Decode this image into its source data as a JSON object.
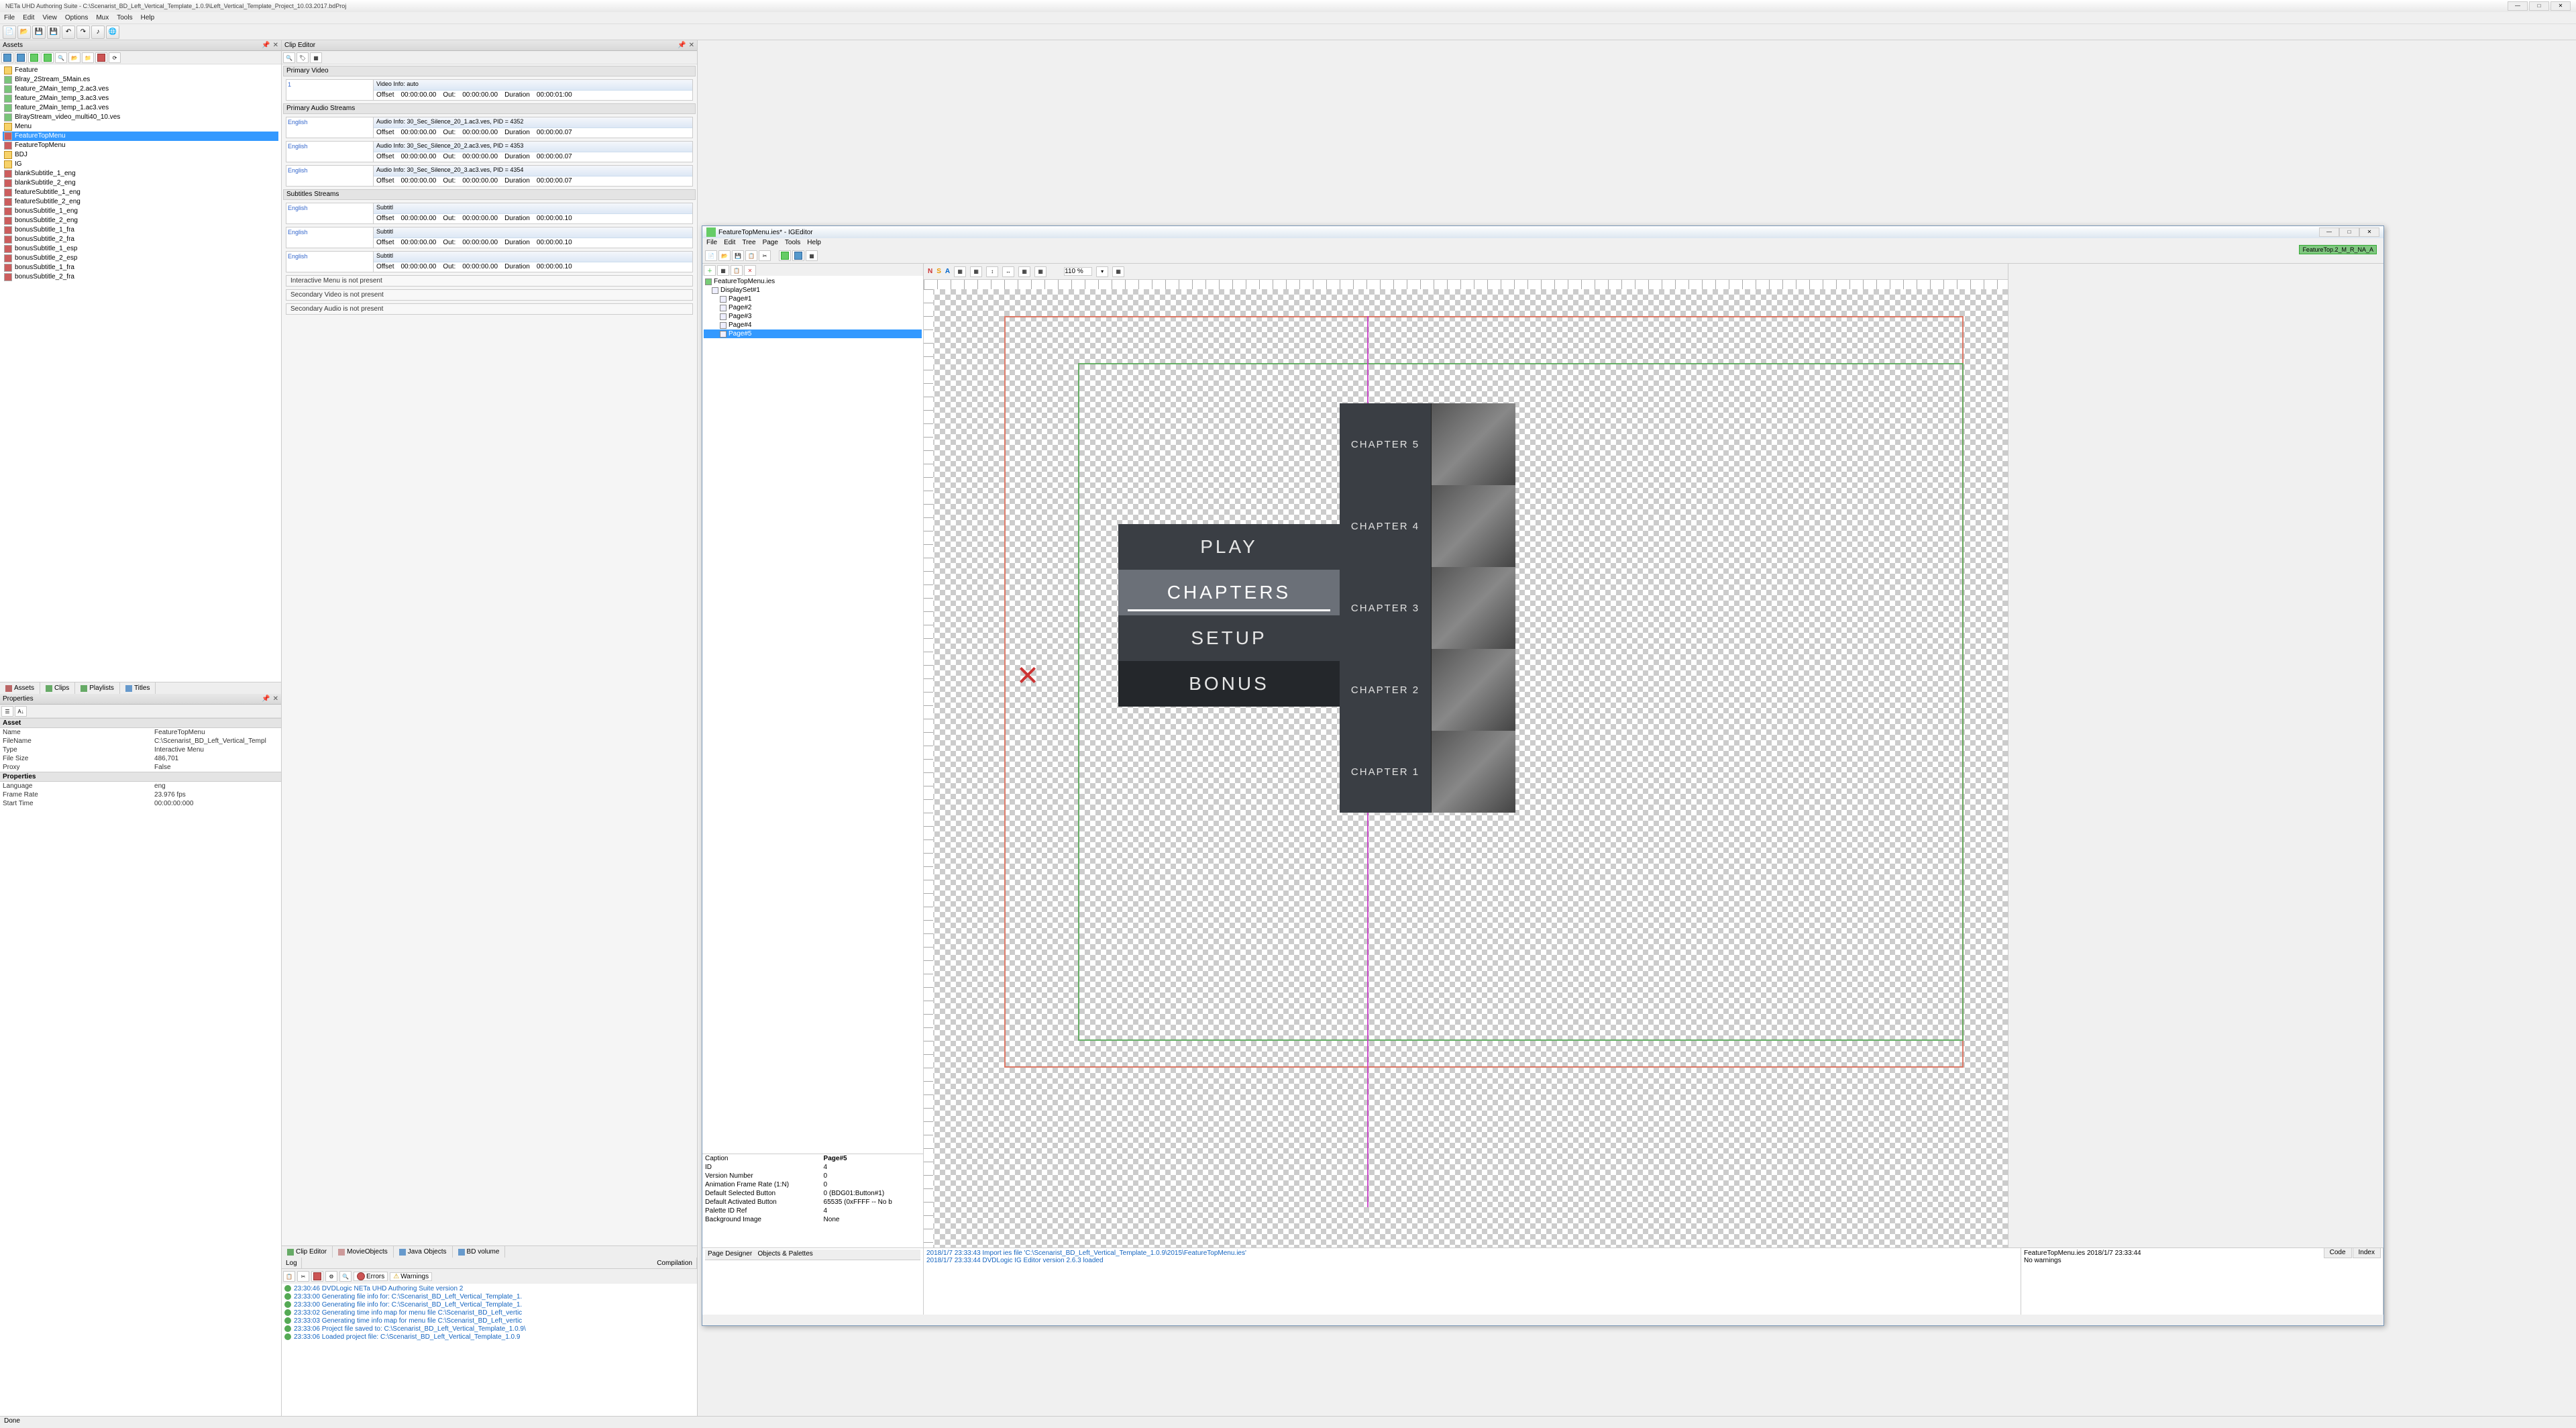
{
  "app": {
    "title": "NETa UHD Authoring Suite - C:\\Scenarist_BD_Left_Vertical_Template_1.0.9\\Left_Vertical_Template_Project_10.03.2017.bdProj",
    "status": "Done"
  },
  "main_menu": [
    "File",
    "Edit",
    "View",
    "Options",
    "Mux",
    "Tools",
    "Help"
  ],
  "assets_panel": {
    "title": "Assets",
    "folders": {
      "feature": "Feature",
      "feature_items": [
        "Blray_2Stream_5Main.es",
        "feature_2Main_temp_2.ac3.ves",
        "feature_2Main_temp_3.ac3.ves",
        "feature_2Main_temp_1.ac3.ves",
        "BlrayStream_video_multi40_10.ves"
      ],
      "menu": "Menu",
      "menu_items": [
        "FeatureTopMenu",
        "FeatureTopMenu"
      ],
      "bdj": "BDJ",
      "ig": "IG",
      "ig_items": [
        "blankSubtitle_1_eng",
        "blankSubtitle_2_eng",
        "featureSubtitle_1_eng",
        "featureSubtitle_2_eng",
        "bonusSubtitle_1_eng",
        "bonusSubtitle_2_eng",
        "bonusSubtitle_1_fra",
        "bonusSubtitle_2_fra",
        "bonusSubtitle_1_esp",
        "bonusSubtitle_2_esp",
        "bonusSubtitle_1_fra",
        "bonusSubtitle_2_fra"
      ]
    }
  },
  "side_tabs": [
    "Assets",
    "Clips",
    "Playlists",
    "Titles"
  ],
  "properties_panel": {
    "title": "Properties",
    "groups": [
      {
        "name": "Asset",
        "rows": [
          {
            "k": "Name",
            "v": "FeatureTopMenu"
          },
          {
            "k": "FileName",
            "v": "C:\\Scenarist_BD_Left_Vertical_Templ"
          },
          {
            "k": "Type",
            "v": "Interactive Menu"
          },
          {
            "k": "File Size",
            "v": "486,701"
          },
          {
            "k": "Proxy",
            "v": "False"
          }
        ]
      },
      {
        "name": "Properties",
        "rows": [
          {
            "k": "Language",
            "v": "eng"
          },
          {
            "k": "Frame Rate",
            "v": "23.976 fps"
          },
          {
            "k": "Start Time",
            "v": "00:00:00:000"
          }
        ]
      }
    ]
  },
  "clip_editor": {
    "title": "Clip Editor",
    "sections": {
      "primary_video": {
        "label": "Primary Video",
        "blocks": [
          {
            "lang": "1",
            "info": "Video Info: auto",
            "offset": "00:00:00.00",
            "out": "00:00:00.00",
            "duration": "00:00:01:00"
          }
        ]
      },
      "primary_audio": {
        "label": "Primary Audio Streams",
        "blocks": [
          {
            "lang": "English",
            "info": "Audio Info: 30_Sec_Silence_20_1.ac3.ves, PID = 4352",
            "offset": "00:00:00.00",
            "out": "00:00:00.00",
            "duration": "00:00:00.07"
          },
          {
            "lang": "English",
            "info": "Audio Info: 30_Sec_Silence_20_2.ac3.ves, PID = 4353",
            "offset": "00:00:00.00",
            "out": "00:00:00.00",
            "duration": "00:00:00.07"
          },
          {
            "lang": "English",
            "info": "Audio Info: 30_Sec_Silence_20_3.ac3.ves, PID = 4354",
            "offset": "00:00:00.00",
            "out": "00:00:00.00",
            "duration": "00:00:00.07"
          }
        ]
      },
      "subtitles": {
        "label": "Subtitles Streams",
        "blocks": [
          {
            "lang": "English",
            "info": "Subtitl",
            "offset": "00:00:00.00",
            "out": "00:00:00.00",
            "duration": "00:00:00.10"
          },
          {
            "lang": "English",
            "info": "Subtitl",
            "offset": "00:00:00.00",
            "out": "00:00:00.00",
            "duration": "00:00:00.10"
          },
          {
            "lang": "English",
            "info": "Subtitl",
            "offset": "00:00:00.00",
            "out": "00:00:00.00",
            "duration": "00:00:00.10"
          }
        ]
      },
      "notices": [
        "Interactive Menu is not present",
        "Secondary Video is not present",
        "Secondary Audio is not present"
      ]
    },
    "bottom_tabs": [
      "Clip Editor",
      "MovieObjects",
      "Java Objects",
      "BD volume"
    ]
  },
  "log_panel": {
    "tabs": [
      "Log",
      "Compilation"
    ],
    "buttons": [
      "Errors",
      "Warnings"
    ],
    "lines": [
      "23:30:46 DVDLogic NETa UHD Authoring Suite version 2",
      "23:33:00 Generating file info for: C:\\Scenarist_BD_Left_Vertical_Template_1.",
      "23:33:00 Generating file info for: C:\\Scenarist_BD_Left_Vertical_Template_1.",
      "23:33:02 Generating time info map for menu file C:\\Scenarist_BD_Left_vertic",
      "23:33:03 Generating time info map for menu file C:\\Scenarist_BD_Left_vertic",
      "23:33:06 Project file saved to: C:\\Scenarist_BD_Left_Vertical_Template_1.0.9\\",
      "23:33:06 Loaded project file: C:\\Scenarist_BD_Left_Vertical_Template_1.0.9"
    ]
  },
  "ig_editor": {
    "title": "FeatureTopMenu.ies* - IGEditor",
    "menu": [
      "File",
      "Edit",
      "Tree",
      "Page",
      "Tools",
      "Help"
    ],
    "zoom": "110 %",
    "res_chip": "FeatureTop.2_M_R_NA_A",
    "tree": {
      "root": "FeatureTopMenu.ies",
      "dispset": "DisplaySet#1",
      "pages": [
        "Page#1",
        "Page#2",
        "Page#3",
        "Page#4",
        "Page#5"
      ],
      "selected": "Page#5"
    },
    "page_props": [
      {
        "k": "Caption",
        "v": "Page#5"
      },
      {
        "k": "ID",
        "v": "4"
      },
      {
        "k": "Version Number",
        "v": "0"
      },
      {
        "k": "Animation Frame Rate (1:N)",
        "v": "0"
      },
      {
        "k": "Default Selected Button",
        "v": "0 (BDG01:Button#1)"
      },
      {
        "k": "Default Activated Button",
        "v": "65535 (0xFFFF -- No b"
      },
      {
        "k": "Palette ID Ref",
        "v": "4"
      },
      {
        "k": "Background Image",
        "v": "None"
      }
    ],
    "menu_mock": {
      "items": [
        "PLAY",
        "CHAPTERS",
        "SETUP",
        "BONUS"
      ],
      "active_index": 1
    },
    "chapters": [
      "CHAPTER 5",
      "CHAPTER 4",
      "CHAPTER 3",
      "CHAPTER 2",
      "CHAPTER 1"
    ],
    "bottom_tabs_left": "Page Designer",
    "bottom_tabs_left2": "Objects & Palettes",
    "right_tabs": [
      "Code",
      "Index"
    ],
    "log": [
      "2018/1/7 23:33:43 Import ies file 'C:\\Scenarist_BD_Left_Vertical_Template_1.0.9\\2015\\FeatureTopMenu.ies'",
      "2018/1/7 23:33:44 DVDLogic IG Editor version 2.6.3 loaded"
    ],
    "status_right": {
      "file": "FeatureTopMenu.ies 2018/1/7 23:33:44",
      "warnings": "No warnings"
    }
  }
}
